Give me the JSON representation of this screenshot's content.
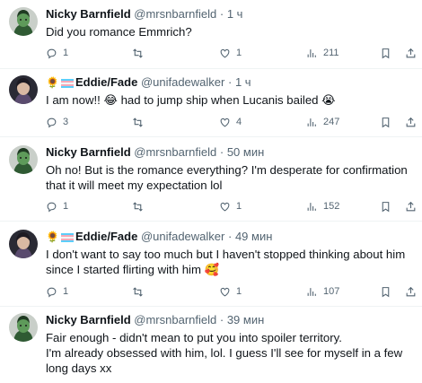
{
  "tweets": [
    {
      "name": "Nicky Barnfield",
      "handle": "@mrsnbarnfield",
      "separator": "·",
      "time": "1 ч",
      "text": "Did you romance Emmrich?",
      "reply_count": "1",
      "retweet_count": "",
      "like_count": "1",
      "view_count": "211"
    },
    {
      "name": "Eddie/Fade",
      "name_prefix_emoji": "🌻",
      "handle": "@unifadewalker",
      "separator": "·",
      "time": "1 ч",
      "text": "I am now!! 😂 had to jump ship when Lucanis bailed 😭",
      "reply_count": "3",
      "retweet_count": "",
      "like_count": "4",
      "view_count": "247"
    },
    {
      "name": "Nicky Barnfield",
      "handle": "@mrsnbarnfield",
      "separator": "·",
      "time": "50 мин",
      "text": "Oh no!  But is the romance everything? I'm desperate for confirmation that it will meet my expectation lol",
      "reply_count": "1",
      "retweet_count": "",
      "like_count": "1",
      "view_count": "152"
    },
    {
      "name": "Eddie/Fade",
      "name_prefix_emoji": "🌻",
      "handle": "@unifadewalker",
      "separator": "·",
      "time": "49 мин",
      "text": "I don't want to say too much but I haven't stopped thinking about him since I started flirting with him 🥰",
      "reply_count": "1",
      "retweet_count": "",
      "like_count": "1",
      "view_count": "107"
    },
    {
      "name": "Nicky Barnfield",
      "handle": "@mrsnbarnfield",
      "separator": "·",
      "time": "39 мин",
      "text": "Fair enough - didn't mean to put you into spoiler territory.\n I'm already obsessed with him, lol. I guess I'll see for myself in a few long days xx",
      "reply_count": "",
      "retweet_count": "",
      "like_count": "",
      "view_count": ""
    }
  ],
  "icons": {
    "reply": "reply-icon",
    "retweet": "retweet-icon",
    "like": "heart-icon",
    "views": "views-icon",
    "bookmark": "bookmark-icon",
    "share": "share-icon",
    "flag": "transgender-flag-icon"
  },
  "colors": {
    "text": "#0f1419",
    "secondary": "#536471",
    "divider": "#eff3f4",
    "flag_blue": "#5bcefa",
    "flag_pink": "#f5a9b8",
    "flag_white": "#ffffff"
  }
}
